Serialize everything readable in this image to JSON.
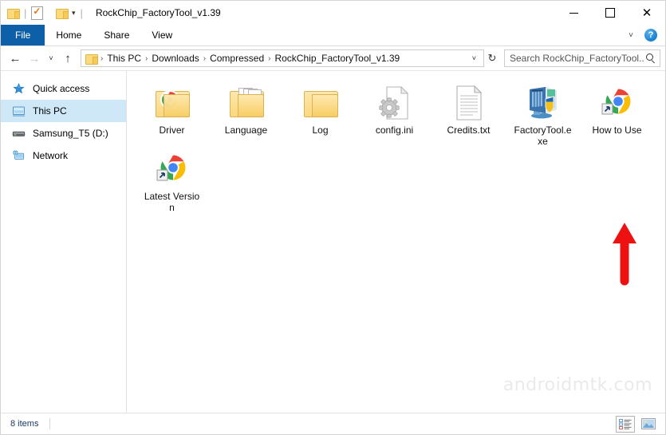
{
  "window": {
    "title": "RockChip_FactoryTool_v1.39",
    "quick_access_toolbar": [
      {
        "name": "folder-icon",
        "label": ""
      },
      {
        "name": "properties-icon",
        "label": ""
      },
      {
        "name": "new-folder-icon",
        "label": ""
      },
      {
        "name": "customize-caret-icon",
        "label": "▾"
      }
    ],
    "controls": {
      "minimize": "—",
      "maximize": "□",
      "close": "✕"
    }
  },
  "ribbon": {
    "tabs": [
      {
        "label": "File",
        "active": true
      },
      {
        "label": "Home",
        "active": false
      },
      {
        "label": "Share",
        "active": false
      },
      {
        "label": "View",
        "active": false
      }
    ],
    "expand_caret": "˅",
    "help_label": "?"
  },
  "address": {
    "back": "←",
    "forward": "→",
    "recent_caret": "˅",
    "up": "↑",
    "breadcrumbs": [
      "This PC",
      "Downloads",
      "Compressed",
      "RockChip_FactoryTool_v1.39"
    ],
    "separator": "›",
    "dropdown_caret": "˅",
    "refresh": "↻"
  },
  "search": {
    "placeholder": "Search RockChip_FactoryTool...",
    "value": ""
  },
  "sidebar": {
    "items": [
      {
        "label": "Quick access",
        "icon": "star-icon",
        "selected": false
      },
      {
        "label": "This PC",
        "icon": "computer-icon",
        "selected": true
      },
      {
        "label": "Samsung_T5 (D:)",
        "icon": "drive-icon",
        "selected": false
      },
      {
        "label": "Network",
        "icon": "network-icon",
        "selected": false
      }
    ]
  },
  "files": [
    {
      "name": "Driver",
      "type": "folder-chrome",
      "icon": "folder-with-chrome-icon"
    },
    {
      "name": "Language",
      "type": "folder-docs",
      "icon": "folder-with-documents-icon"
    },
    {
      "name": "Log",
      "type": "folder",
      "icon": "folder-icon"
    },
    {
      "name": "config.ini",
      "type": "ini",
      "icon": "gear-config-file-icon"
    },
    {
      "name": "Credits.txt",
      "type": "txt",
      "icon": "text-document-icon"
    },
    {
      "name": "FactoryTool.exe",
      "type": "exe",
      "icon": "application-shield-icon"
    },
    {
      "name": "How to Use",
      "type": "chrome-shortcut",
      "icon": "chrome-shortcut-icon"
    },
    {
      "name": "Latest Version",
      "type": "chrome-shortcut",
      "icon": "chrome-shortcut-icon"
    }
  ],
  "annotation": {
    "arrow_color": "#ee1111",
    "points_at": "FactoryTool.exe"
  },
  "watermark": {
    "text": "androidmtk.com"
  },
  "statusbar": {
    "item_count": "8 items",
    "views": [
      {
        "name": "details-view-button",
        "active": true
      },
      {
        "name": "large-icons-view-button",
        "active": false
      }
    ]
  },
  "colors": {
    "accent": "#0d5fa8",
    "selection": "#cfe8f7",
    "arrow": "#ee1111",
    "watermark": "#eaeaea"
  }
}
